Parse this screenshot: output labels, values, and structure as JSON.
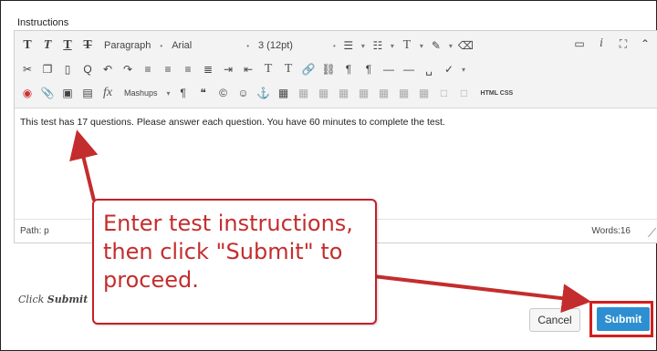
{
  "section": {
    "label": "Instructions"
  },
  "toolbar": {
    "row1": {
      "bold": "T",
      "italic": "T",
      "underline": "T",
      "strike": "T",
      "paragraph": "Paragraph",
      "font": "Arial",
      "size": "3 (12pt)"
    },
    "row2": {
      "super": "T",
      "sub": "T",
      "clear": "T"
    },
    "row3": {
      "mashups": "Mashups",
      "html_css": "HTML CSS"
    }
  },
  "editor": {
    "content": "This test has 17 questions. Please answer each question. You have 60 minutes to complete the test.",
    "path_label": "Path: p",
    "words_label": "Words:16"
  },
  "footer": {
    "note_prefix": "Click",
    "note_bold": "Submit",
    "cancel": "Cancel",
    "submit": "Submit"
  },
  "annotation": {
    "text": "Enter test instructions, then click \"Submit\" to proceed.",
    "color": "#c42d2d"
  }
}
